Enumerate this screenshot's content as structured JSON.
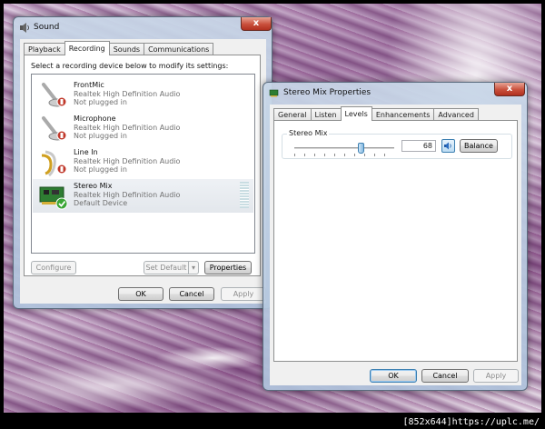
{
  "sound": {
    "title": "Sound",
    "close": "x",
    "tabs": [
      "Playback",
      "Recording",
      "Sounds",
      "Communications"
    ],
    "active_tab": "Recording",
    "instruction": "Select a recording device below to modify its settings:",
    "devices": [
      {
        "name": "FrontMic",
        "desc": "Realtek High Definition Audio",
        "status": "Not plugged in",
        "icon": "microphone-icon"
      },
      {
        "name": "Microphone",
        "desc": "Realtek High Definition Audio",
        "status": "Not plugged in",
        "icon": "microphone-icon"
      },
      {
        "name": "Line In",
        "desc": "Realtek High Definition Audio",
        "status": "Not plugged in",
        "icon": "line-in-icon"
      },
      {
        "name": "Stereo Mix",
        "desc": "Realtek High Definition Audio",
        "status": "Default Device",
        "icon": "sound-card-icon"
      }
    ],
    "buttons": {
      "configure": "Configure",
      "set_default": "Set Default",
      "properties": "Properties",
      "ok": "OK",
      "cancel": "Cancel",
      "apply": "Apply"
    }
  },
  "props": {
    "title": "Stereo Mix Properties",
    "close": "x",
    "tabs": [
      "General",
      "Listen",
      "Levels",
      "Enhancements",
      "Advanced"
    ],
    "active_tab": "Levels",
    "group_label": "Stereo Mix",
    "level": 68,
    "level_text": "68",
    "buttons": {
      "balance": "Balance",
      "ok": "OK",
      "cancel": "Cancel",
      "apply": "Apply"
    }
  },
  "watermark": "[852x644]https://uplc.me/"
}
